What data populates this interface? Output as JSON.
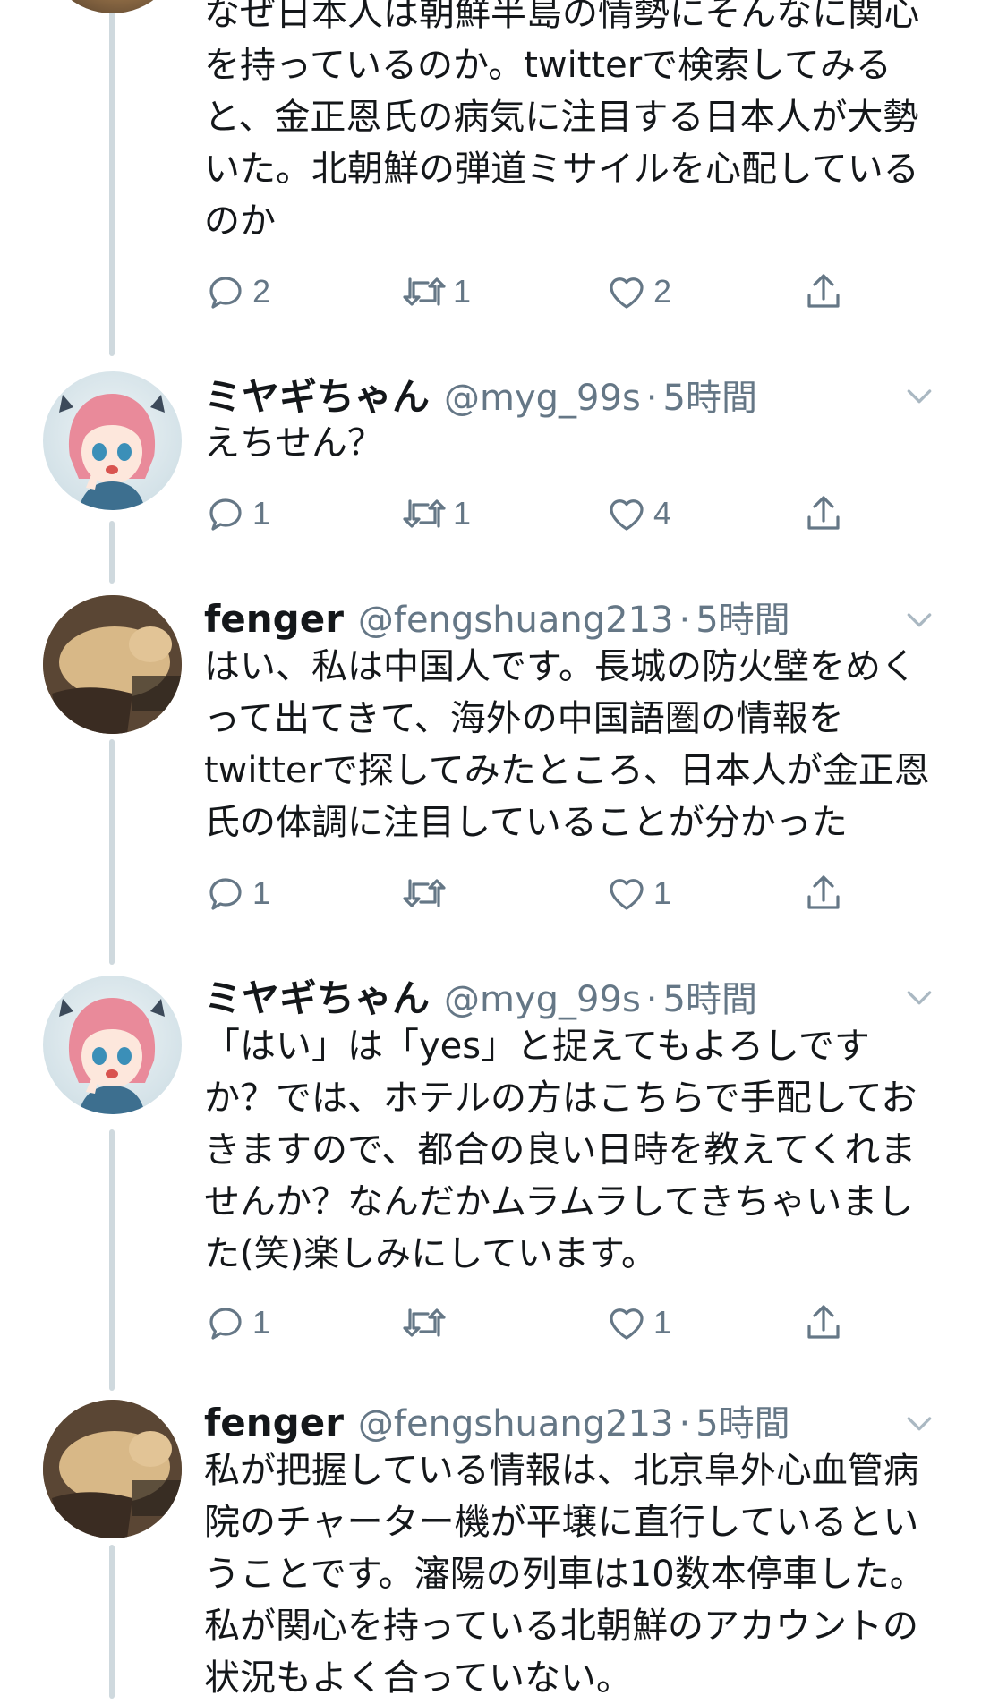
{
  "tweets": [
    {
      "name": "",
      "handle": "",
      "time": "",
      "lines": [
        "なぜ日本人は朝鮮半島の情勢にそんなに関心",
        "を持っているのか。twitterで検索してみる",
        "と、金正恩氏の病気に注目する日本人が大勢",
        "いた。北朝鮮の弾道ミサイルを心配している",
        "のか"
      ],
      "replies": "2",
      "retweets": "1",
      "likes": "2"
    },
    {
      "name": "ミヤギちゃん",
      "handle": "@myg_99s",
      "time": "5時間",
      "lines": [
        "えちせん？"
      ],
      "replies": "1",
      "retweets": "1",
      "likes": "4"
    },
    {
      "name": "fenger",
      "handle": "@fengshuang213",
      "time": "5時間",
      "lines": [
        "はい、私は中国人です。長城の防火壁をめく",
        "って出てきて、海外の中国語圏の情報を",
        "twitterで探してみたところ、日本人が金正恩",
        "氏の体調に注目していることが分かった"
      ],
      "replies": "1",
      "retweets": "",
      "likes": "1"
    },
    {
      "name": "ミヤギちゃん",
      "handle": "@myg_99s",
      "time": "5時間",
      "lines": [
        "「はい」は「yes」と捉えてもよろしです",
        "か？では、ホテルの方はこちらで手配してお",
        "きますので、都合の良い日時を教えてくれま",
        "せんか？なんだかムラムラしてきちゃいまし",
        "た(笑)楽しみにしています。"
      ],
      "replies": "1",
      "retweets": "",
      "likes": "1"
    },
    {
      "name": "fenger",
      "handle": "@fengshuang213",
      "time": "5時間",
      "lines": [
        "私が把握している情報は、北京阜外心血管病",
        "院のチャーター機が平壌に直行しているとい",
        "うことです。瀋陽の列車は10数本停車した。",
        "私が関心を持っている北朝鮮のアカウントの",
        "状況もよく合っていない。"
      ]
    }
  ],
  "icons": {
    "reply": "reply-bubble-icon",
    "retweet": "retweet-icon",
    "like": "heart-icon",
    "share": "share-upload-icon",
    "more": "chevron-down-icon",
    "avatar_anime": "anime-girl-avatar",
    "avatar_dog": "dog-photo-avatar"
  },
  "colors": {
    "text": "#14171a",
    "secondary": "#657786",
    "thread_line": "#cfd9de"
  }
}
